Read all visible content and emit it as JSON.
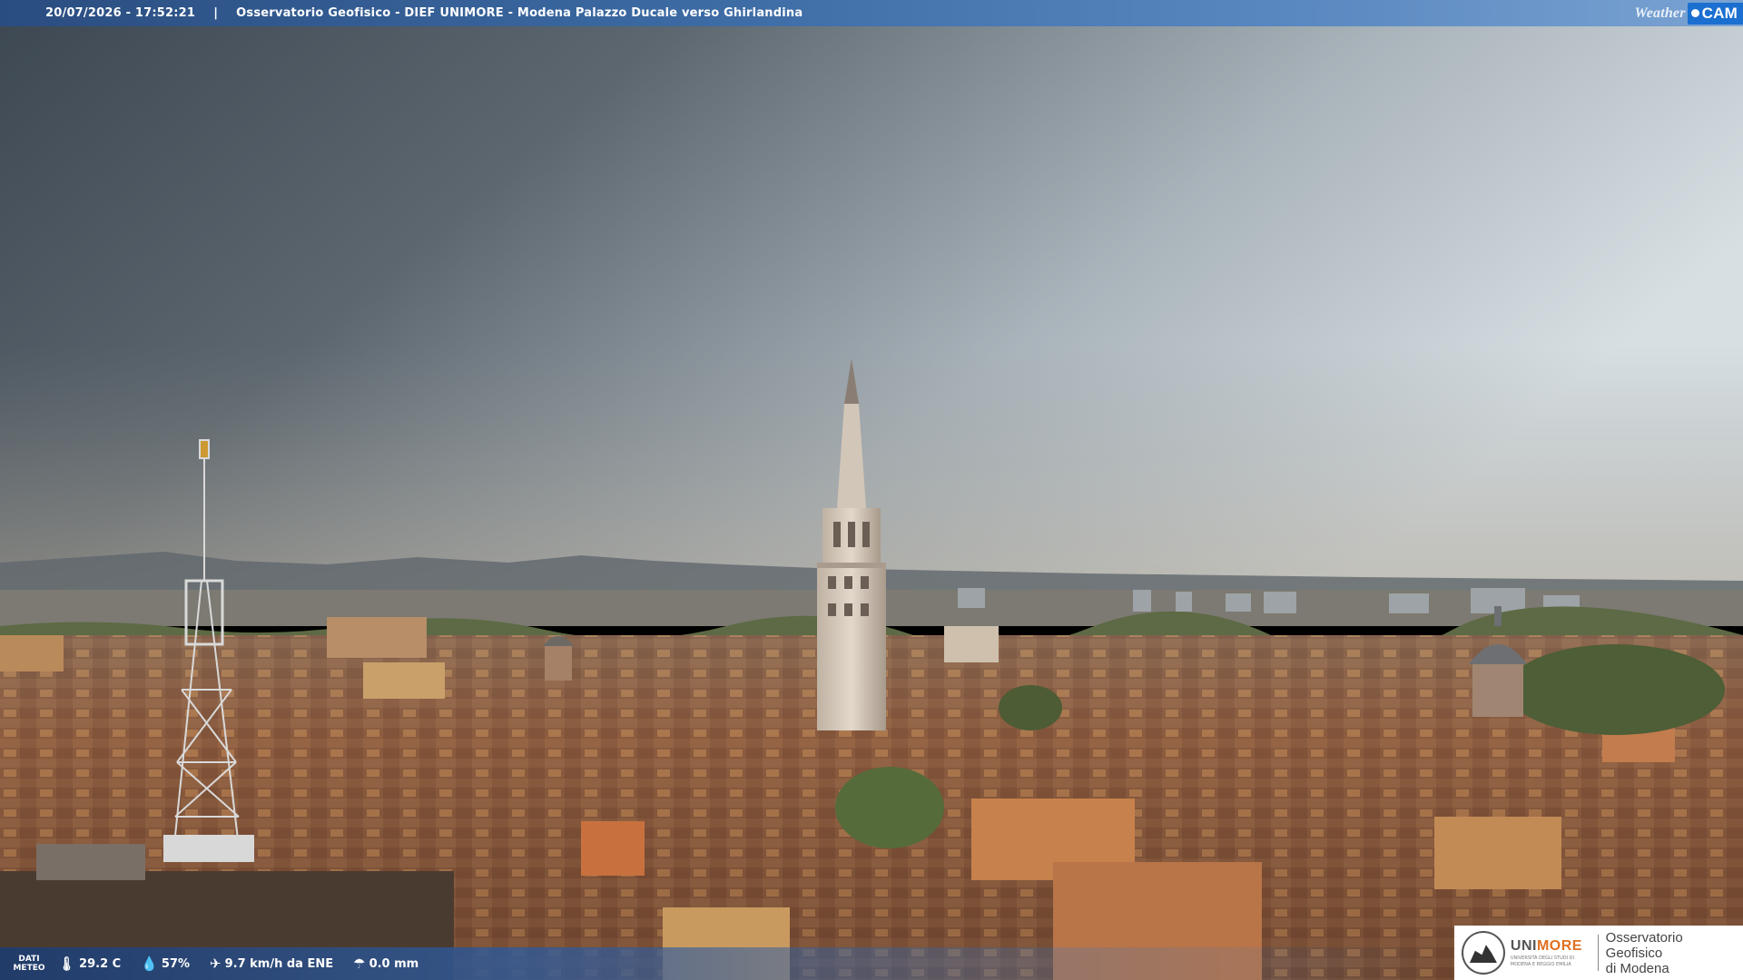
{
  "top_bar": {
    "timestamp": "20/07/2026 - 17:52:21",
    "separator": "|",
    "title": "Osservatorio Geofisico - DIEF UNIMORE - Modena Palazzo Ducale verso Ghirlandina",
    "brand_weather": "Weather",
    "brand_cam": "CAM"
  },
  "weather_bar": {
    "label_line1": "DATI",
    "label_line2": "METEO",
    "temperature": "29.2 C",
    "humidity": "57%",
    "wind": "9.7 km/h da ENE",
    "rain": "0.0 mm",
    "icons": [
      "thermometer-icon",
      "humidity-icon",
      "wind-icon",
      "rain-icon"
    ]
  },
  "logo": {
    "uni_part1": "UNI",
    "uni_part2": "MORE",
    "uni_sub_line1": "UNIVERSITÀ DEGLI STUDI DI",
    "uni_sub_line2": "MODENA E REGGIO EMILIA",
    "obs_line1": "Osservatorio Geofisico",
    "obs_line2": "di Modena"
  },
  "colors": {
    "sky_top": "#3f4a55",
    "sky_bright": "#d4dde2",
    "roof": "#8a5a3c",
    "tower": "#d8c9b8",
    "accent_orange": "#e07020",
    "bar_blue": "#2a4d80"
  }
}
